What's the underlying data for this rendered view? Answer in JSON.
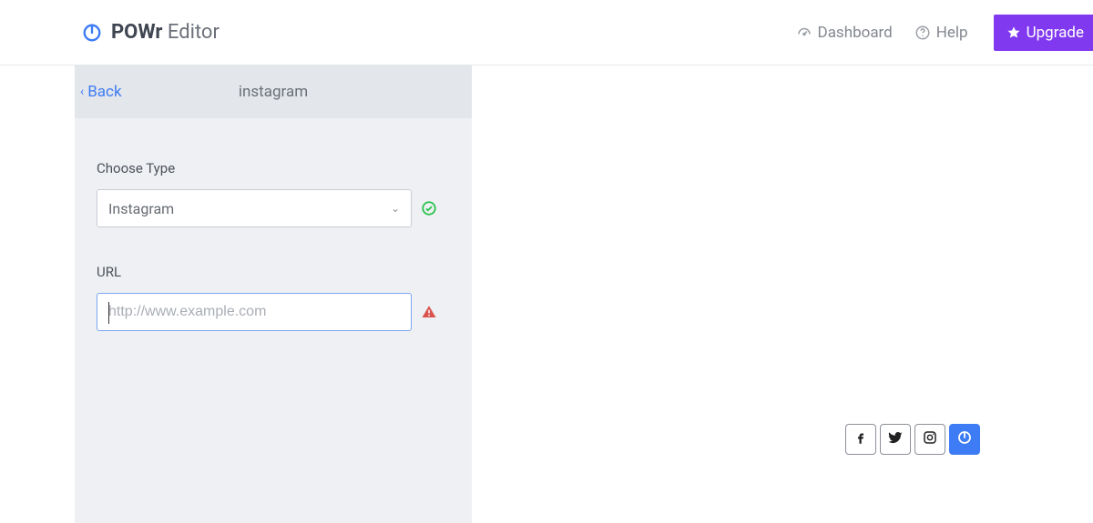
{
  "brand": {
    "name_bold": "POWr",
    "name_rest": " Editor"
  },
  "header": {
    "dashboard": "Dashboard",
    "help": "Help",
    "upgrade": "Upgrade"
  },
  "sidebar": {
    "back": "Back",
    "title": "instagram",
    "type_label": "Choose Type",
    "type_value": "Instagram",
    "url_label": "URL",
    "url_placeholder": "http://www.example.com",
    "url_value": ""
  },
  "icons": {
    "logo": "powr-logo-icon",
    "dashboard": "gauge-icon",
    "help": "question-circle-icon",
    "star": "star-icon",
    "chevron_left": "chevron-left-icon",
    "chevron_down": "chevron-down-icon",
    "check": "check-circle-icon",
    "warn": "warning-triangle-icon",
    "facebook": "facebook-icon",
    "twitter": "twitter-icon",
    "instagram": "instagram-icon",
    "powr": "powr-icon"
  },
  "colors": {
    "accent": "#8139ef",
    "link": "#3d7cf4",
    "success": "#27c24c",
    "danger": "#d9534f",
    "sidebar_bg": "#eef0f3"
  }
}
